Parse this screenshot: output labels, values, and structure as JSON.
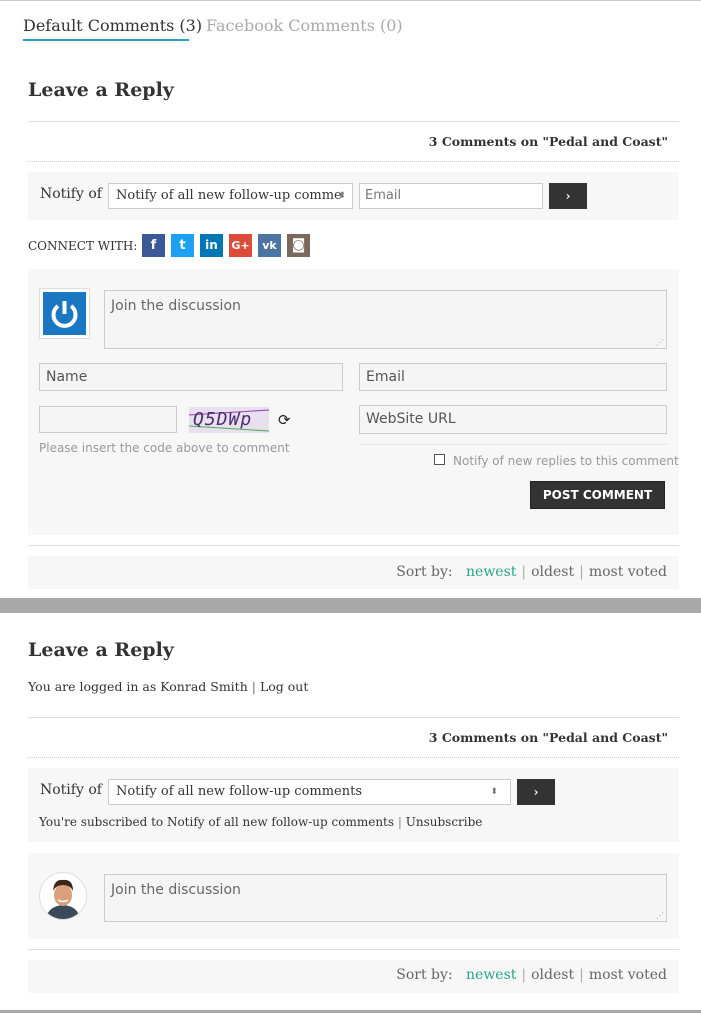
{
  "tabs": {
    "default_comments": "Default Comments (3)",
    "facebook_comments": "Facebook Comments (0)"
  },
  "guest": {
    "heading": "Leave a Reply",
    "comments_count": "3 Comments on \"Pedal and Coast\"",
    "notify_label": "Notify of",
    "notify_select_value": "Notify of all new follow-up comme",
    "email_placeholder": "Email",
    "go_label": "›",
    "connect_label": "CONNECT WITH:",
    "social": [
      {
        "name": "facebook",
        "glyph": "f",
        "color": "#3b5998"
      },
      {
        "name": "twitter",
        "glyph": "t",
        "color": "#1da1f2"
      },
      {
        "name": "linkedin",
        "glyph": "in",
        "color": "#0077b5"
      },
      {
        "name": "google-plus",
        "glyph": "G+",
        "color": "#dd4b39"
      },
      {
        "name": "vk",
        "glyph": "vk",
        "color": "#4c75a3"
      },
      {
        "name": "instagram",
        "glyph": "◙",
        "color": "#7b6a5c"
      }
    ],
    "discussion_placeholder": "Join the discussion",
    "name_placeholder": "Name",
    "email_field_placeholder": "Email",
    "captcha_text": "Q5DWp",
    "captcha_hint": "Please insert the code above to comment",
    "website_placeholder": "WebSite URL",
    "notify_replies_label": "Notify of new replies to this comment",
    "post_comment_label": "POST COMMENT",
    "sort_label": "Sort by:",
    "sort_newest": "newest",
    "sort_oldest": "oldest",
    "sort_most_voted": "most voted"
  },
  "logged": {
    "heading": "Leave a Reply",
    "logged_in_text": "You are logged in as Konrad Smith",
    "separator": "|",
    "logout_label": "Log out",
    "comments_count": "3 Comments on \"Pedal and Coast\"",
    "notify_label": "Notify of",
    "notify_select_value": "Notify of all new follow-up comments",
    "go_label": "›",
    "subscribed_text": "You're subscribed to Notify of all new follow-up comments",
    "unsubscribe_label": "Unsubscribe",
    "discussion_placeholder": "Join the discussion",
    "sort_label": "Sort by:",
    "sort_newest": "newest",
    "sort_oldest": "oldest",
    "sort_most_voted": "most voted"
  },
  "colors": {
    "accent_tab": "#2ca0c6",
    "sort_active": "#2aa38a",
    "divider": "#a9a9a9"
  }
}
